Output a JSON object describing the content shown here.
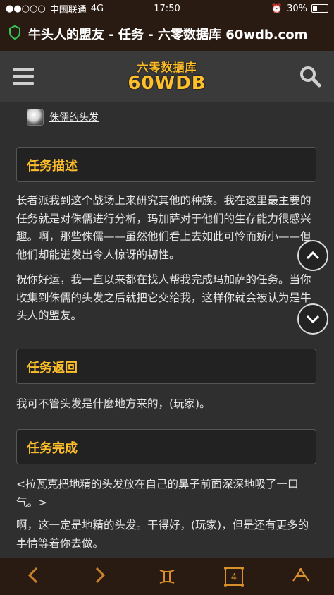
{
  "status_bar": {
    "signal": "●●○○○",
    "carrier": "中国联通",
    "network": "4G",
    "time": "17:50",
    "battery": "30%"
  },
  "browser": {
    "page_title": "牛头人的盟友 - 任务 - 六零数据库 60wdb.com"
  },
  "header": {
    "logo_cn": "六零数据库",
    "logo_en": "60WDB"
  },
  "item": {
    "name": "侏儒的头发"
  },
  "sections": [
    {
      "title": "任务描述",
      "paragraphs": [
        "长者派我到这个战场上来研究其他的种族。我在这里最主要的任务就是对侏儒进行分析，玛加萨对于他们的生存能力很感兴趣。啊，那些侏儒——虽然他们看上去如此可怜而娇小——但他们却能迸发出令人惊讶的韧性。",
        "祝你好运，我一直以来都在找人帮我完成玛加萨的任务。当你收集到侏儒的头发之后就把它交给我，这样你就会被认为是牛头人的盟友。"
      ]
    },
    {
      "title": "任务返回",
      "paragraphs": [
        "我可不管头发是什麼地方来的，(玩家)。"
      ]
    },
    {
      "title": "任务完成",
      "paragraphs": [
        "<拉瓦克把地精的头发放在自己的鼻子前面深深地吸了一口气。>",
        "啊，这一定是地精的头发。干得好，(玩家)，但是还有更多的事情等着你去做。"
      ]
    }
  ],
  "bottom_nav": {
    "page_number": "4"
  },
  "colors": {
    "accent": "#ffbf2a",
    "background": "#2f2f2f",
    "bars": "#2a1b12"
  }
}
